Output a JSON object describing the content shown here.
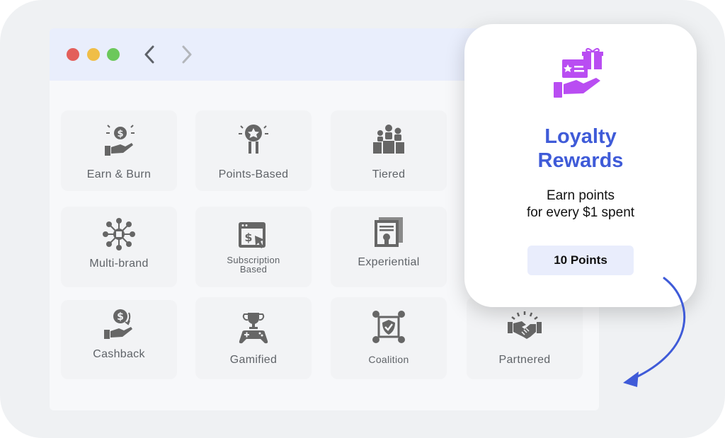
{
  "browser": {
    "controls": [
      "close",
      "minimize",
      "maximize"
    ],
    "nav": [
      "chevron-left-icon",
      "chevron-right-icon"
    ]
  },
  "programs": [
    {
      "label": "Earn & Burn",
      "icon": "hand-coin-icon"
    },
    {
      "label": "Points-Based",
      "icon": "award-ribbon-icon"
    },
    {
      "label": "Tiered",
      "icon": "podium-people-icon"
    },
    {
      "label": "Multi-brand",
      "icon": "network-hub-icon"
    },
    {
      "label": "Subscription\nBased",
      "icon": "subscription-window-icon"
    },
    {
      "label": "Experiential",
      "icon": "certificate-icon"
    },
    {
      "label": "Cashback",
      "icon": "cashback-hand-icon"
    },
    {
      "label": "Gamified",
      "icon": "trophy-gamepad-icon"
    },
    {
      "label": "Coalition",
      "icon": "coalition-shield-icon"
    },
    {
      "label": "Partnered",
      "icon": "handshake-icon"
    }
  ],
  "reward": {
    "icon": "gift-card-hand-icon",
    "title_line1": "Loyalty",
    "title_line2": "Rewards",
    "desc_line1": "Earn points",
    "desc_line2": "for every $1 spent",
    "points": "10 Points"
  },
  "colors": {
    "accent": "#3f5bd8",
    "reward_icon": "#b94df2",
    "card_bg": "#f2f3f5",
    "icon_gray": "#666666"
  }
}
